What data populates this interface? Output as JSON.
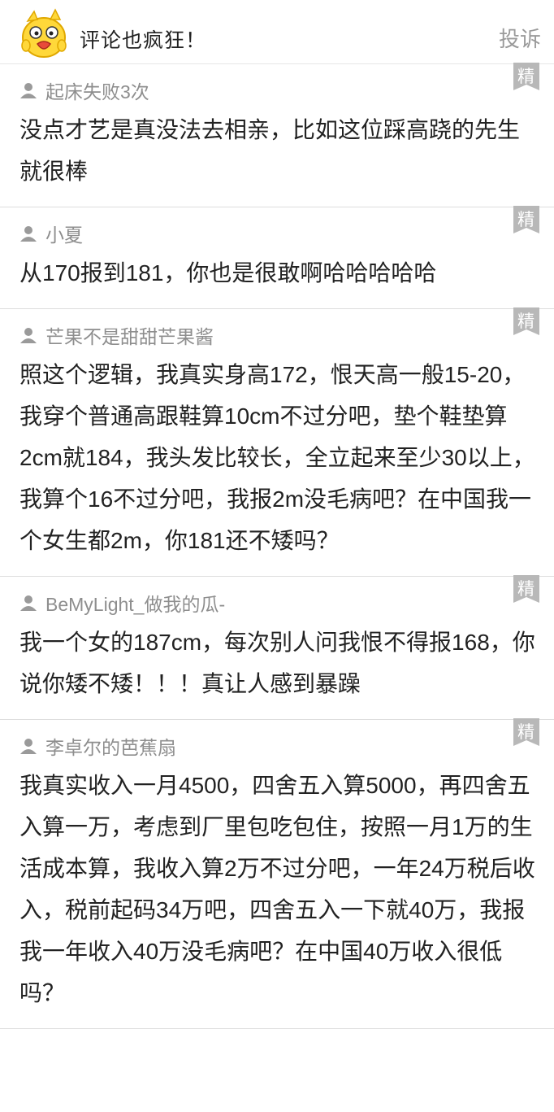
{
  "header": {
    "title": "评论也疯狂！",
    "report_label": "投诉",
    "mascot_icon": "yellow-chick-mascot-icon"
  },
  "badge_text": "精",
  "colors": {
    "username": "#8e8e8e",
    "badge": "#b8b8b8",
    "report": "#9a9a9a",
    "divider": "#dedede"
  },
  "comments": [
    {
      "user": "起床失败3次",
      "text": "没点才艺是真没法去相亲，比如这位踩高跷的先生就很棒"
    },
    {
      "user": "小夏",
      "text": "从170报到181，你也是很敢啊哈哈哈哈哈"
    },
    {
      "user": "芒果不是甜甜芒果酱",
      "text": "照这个逻辑，我真实身高172，恨天高一般15-20，我穿个普通高跟鞋算10cm不过分吧，垫个鞋垫算2cm就184，我头发比较长，全立起来至少30以上，我算个16不过分吧，我报2m没毛病吧？在中国我一个女生都2m，你181还不矮吗？"
    },
    {
      "user": "BeMyLight_做我的瓜-",
      "text": "我一个女的187cm，每次别人问我恨不得报168，你说你矮不矮！！！真让人感到暴躁"
    },
    {
      "user": "李卓尔的芭蕉扇",
      "text": "我真实收入一月4500，四舍五入算5000，再四舍五入算一万，考虑到厂里包吃包住，按照一月1万的生活成本算，我收入算2万不过分吧，一年24万税后收入，税前起码34万吧，四舍五入一下就40万，我报我一年收入40万没毛病吧？在中国40万收入很低吗？"
    }
  ]
}
